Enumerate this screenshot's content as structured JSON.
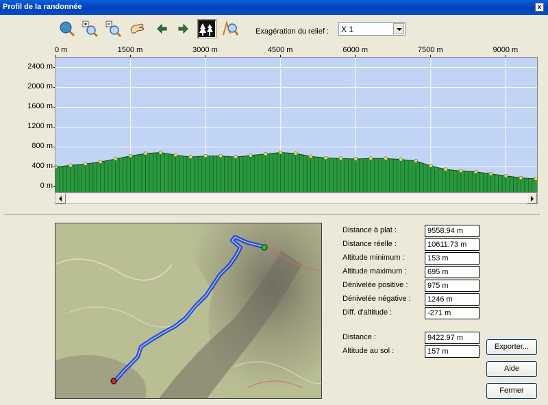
{
  "window": {
    "title": "Profil de la randonnée",
    "close_glyph": "x"
  },
  "toolbar": {
    "tools": [
      {
        "icon": "globe-zoom-icon"
      },
      {
        "icon": "zoom-in-icon"
      },
      {
        "icon": "zoom-out-icon"
      },
      {
        "icon": "pan-hand-icon"
      },
      {
        "icon": "arrow-left-icon"
      },
      {
        "icon": "arrow-right-icon"
      },
      {
        "icon": "forest-profile-icon",
        "active": true
      },
      {
        "icon": "path-zoom-icon"
      }
    ],
    "exaggeration_label": "Exagération du relief :",
    "exaggeration_value": "X 1"
  },
  "chart_data": {
    "type": "area",
    "x_unit": "m",
    "x_ticks": [
      "0 m",
      "1500 m",
      "3000 m",
      "4500 m",
      "6000 m",
      "7500 m",
      "9000 m"
    ],
    "y_ticks": [
      "2400 m",
      "2000 m",
      "1600 m",
      "1200 m",
      "800 m",
      "400 m",
      "0 m"
    ],
    "xlim": [
      0,
      9650
    ],
    "ylim": [
      -130,
      2600
    ],
    "grid": true,
    "colors": {
      "fill": "#2a9a3f",
      "background": "#c1d4f5",
      "marker": "#f3e24a",
      "grid": "#ffffff"
    },
    "x": [
      0,
      300,
      600,
      900,
      1200,
      1500,
      1800,
      2100,
      2400,
      2700,
      3000,
      3300,
      3600,
      3900,
      4200,
      4500,
      4800,
      5100,
      5400,
      5700,
      6000,
      6300,
      6600,
      6900,
      7200,
      7500,
      7800,
      8100,
      8400,
      8700,
      9000,
      9300,
      9600
    ],
    "y": [
      400,
      430,
      460,
      500,
      560,
      620,
      670,
      690,
      640,
      600,
      620,
      620,
      600,
      630,
      660,
      690,
      670,
      610,
      580,
      570,
      560,
      570,
      570,
      550,
      520,
      420,
      350,
      320,
      300,
      260,
      220,
      180,
      160
    ]
  },
  "stats": [
    {
      "label": "Distance à plat :",
      "value": "9558.94 m"
    },
    {
      "label": "Distance réelle :",
      "value": "10611.73 m"
    },
    {
      "label": "Altitude minimum :",
      "value": "153 m"
    },
    {
      "label": "Altitude maximum :",
      "value": "695 m"
    },
    {
      "label": "Dénivelée positive :",
      "value": "975 m"
    },
    {
      "label": "Dénivelée négative :",
      "value": "1246 m"
    },
    {
      "label": "Diff. d'altitude :",
      "value": "-271 m"
    }
  ],
  "cursor": [
    {
      "label": "Distance :",
      "value": "9422.97 m"
    },
    {
      "label": "Altitude au sol :",
      "value": "157 m"
    }
  ],
  "buttons": {
    "export": "Exporter...",
    "help": "Aide",
    "close": "Fermer"
  }
}
